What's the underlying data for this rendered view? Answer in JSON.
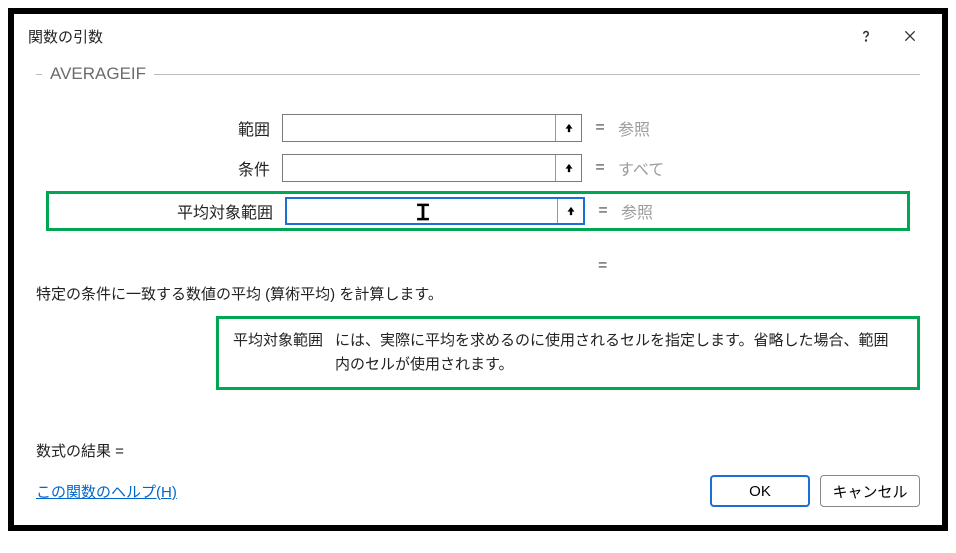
{
  "titlebar": {
    "title": "関数の引数"
  },
  "group": {
    "label": "AVERAGEIF"
  },
  "args": [
    {
      "label": "範囲",
      "value": "",
      "hint": "参照",
      "highlighted": false
    },
    {
      "label": "条件",
      "value": "",
      "hint": "すべて",
      "highlighted": false
    },
    {
      "label": "平均対象範囲",
      "value": "",
      "hint": "参照",
      "highlighted": true
    }
  ],
  "description": {
    "summary": "特定の条件に一致する数値の平均 (算術平均) を計算します。",
    "arg_name": "平均対象範囲",
    "arg_text": "には、実際に平均を求めるのに使用されるセルを指定します。省略した場合、範囲内のセルが使用されます。"
  },
  "formula_result": {
    "label": "数式の結果 =",
    "value": ""
  },
  "footer": {
    "help": "この関数のヘルプ(H)",
    "ok": "OK",
    "cancel": "キャンセル"
  },
  "symbols": {
    "equals": "="
  }
}
